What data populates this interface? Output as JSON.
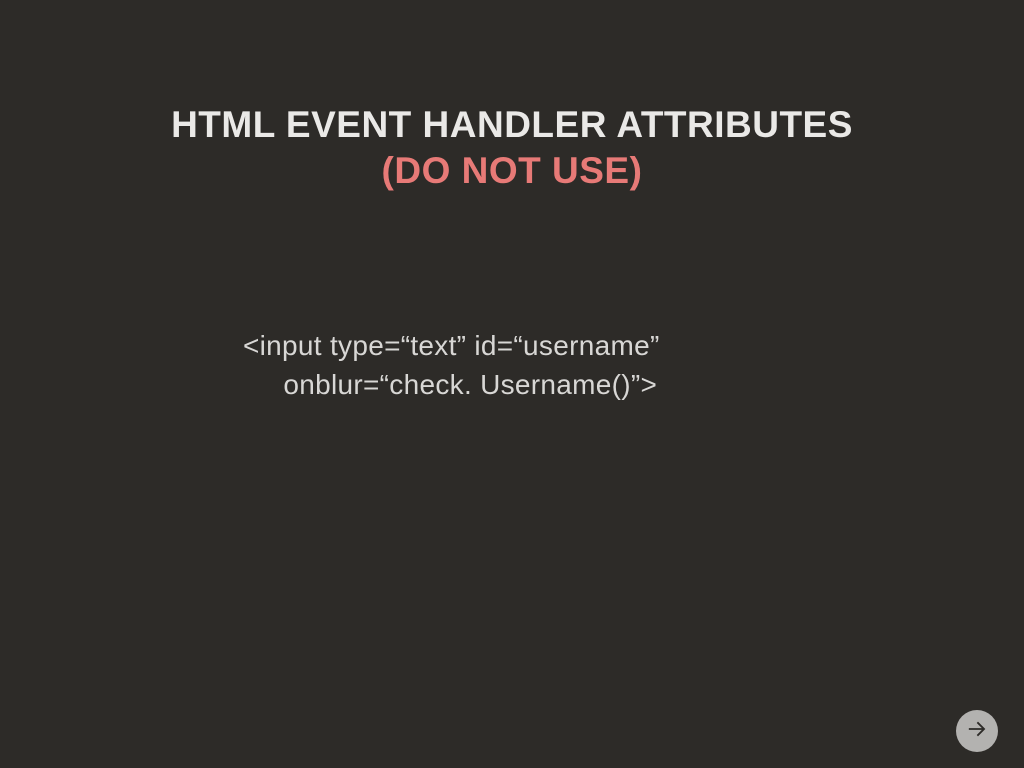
{
  "heading": {
    "line1": "HTML EVENT HANDLER ATTRIBUTES",
    "line2": "(DO NOT USE)"
  },
  "code": {
    "line1": "<input type=“text” id=“username”",
    "line2": "     onblur=“check. Username()”>"
  },
  "nav": {
    "next_label": "Next"
  }
}
